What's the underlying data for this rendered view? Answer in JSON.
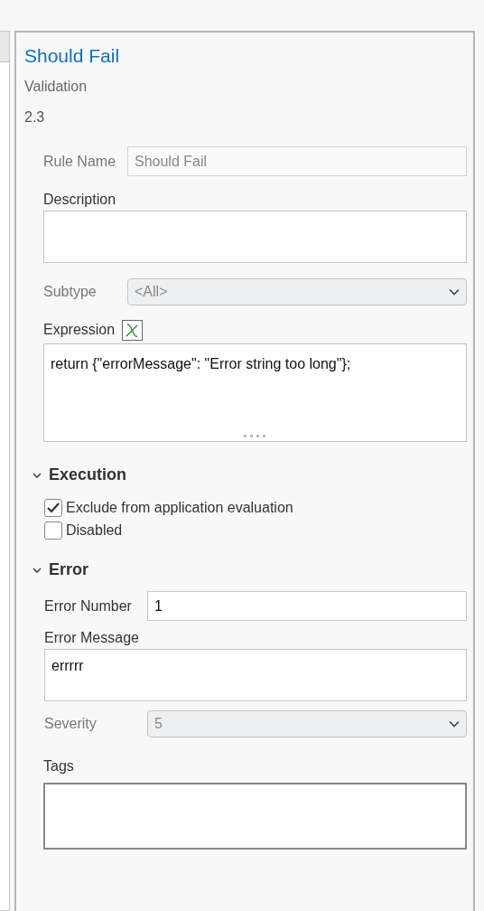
{
  "header": {
    "title": "Should Fail",
    "category": "Validation",
    "version": "2.3"
  },
  "fields": [
    {
      "kind": "inline-text",
      "label": "Rule Name",
      "value": "Should Fail",
      "disabled": true
    },
    {
      "kind": "textarea",
      "label": "Description"
    },
    {
      "kind": "select",
      "label": "Subtype",
      "value": "<All>",
      "disabled": true
    },
    {
      "kind": "code",
      "label": "Expression",
      "value": "return {\"errorMessage\": \"Error string too long\"};"
    }
  ],
  "execution": {
    "title": "Execution",
    "expanded": true,
    "options": [
      {
        "label": "Exclude from application evaluation",
        "checked": true
      },
      {
        "label": "Disabled",
        "checked": false
      }
    ]
  },
  "error": {
    "title": "Error",
    "expanded": true,
    "fields": [
      {
        "kind": "inline-text",
        "label": "Error Number",
        "value": "1",
        "disabled": false
      },
      {
        "kind": "textarea",
        "label": "Error Message",
        "value": "errrrr"
      },
      {
        "kind": "select",
        "label": "Severity",
        "value": "5",
        "disabled": true
      }
    ]
  },
  "tags": {
    "label": "Tags"
  }
}
